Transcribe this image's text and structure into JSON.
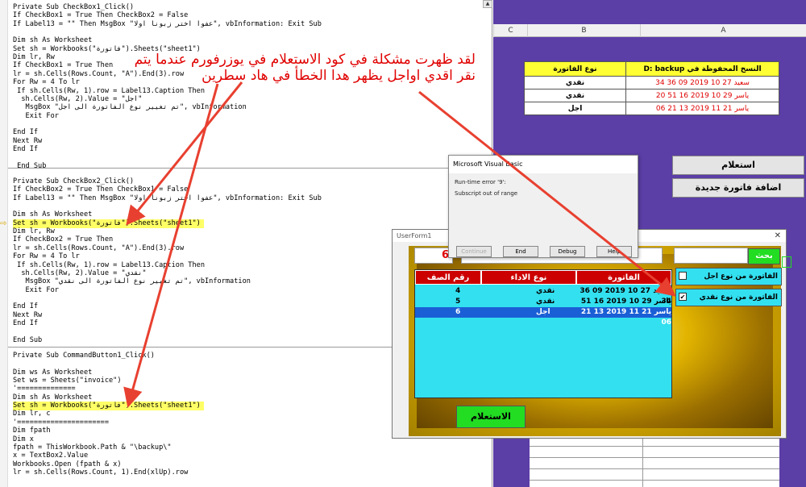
{
  "code": {
    "lines": [
      {
        "text": "Private Sub CheckBox1_Click()"
      },
      {
        "text": "If CheckBox1 = True Then CheckBox2 = False"
      },
      {
        "text": "If Label13 = \"\" Then MsgBox \"عفوا اختر زبونا اولا\", vbInformation: Exit Sub"
      },
      {
        "text": ""
      },
      {
        "text": "Dim sh As Worksheet"
      },
      {
        "text": "Set sh = Workbooks(\"فاتورة\").Sheets(\"sheet1\")"
      },
      {
        "text": "Dim lr, Rw"
      },
      {
        "text": "If CheckBox1 = True Then"
      },
      {
        "text": "lr = sh.Cells(Rows.Count, \"A\").End(3).row"
      },
      {
        "text": "For Rw = 4 To lr"
      },
      {
        "text": " If sh.Cells(Rw, 1).row = Label13.Caption Then"
      },
      {
        "text": "  sh.Cells(Rw, 2).Value = \"اجل\""
      },
      {
        "text": "   MsgBox \"تم تغيير نوع الفاتورة الى اجل\", vbInformation"
      },
      {
        "text": "   Exit For"
      },
      {
        "text": ""
      },
      {
        "text": "End If"
      },
      {
        "text": "Next Rw"
      },
      {
        "text": "End If"
      },
      {
        "text": ""
      },
      {
        "text": " End Sub"
      },
      {
        "text": ""
      },
      {
        "text": "Private Sub CheckBox2_Click()"
      },
      {
        "text": "If CheckBox2 = True Then CheckBox1 = False"
      },
      {
        "text": "If Label13 = \"\" Then MsgBox \"عفوا اختر زبونا اولا\", vbInformation: Exit Sub"
      },
      {
        "text": ""
      },
      {
        "text": "Dim sh As Worksheet"
      },
      {
        "text": "Set sh = Workbooks(\"فاتورة\").Sheets(\"sheet1\")",
        "highlight": true
      },
      {
        "text": "Dim lr, Rw"
      },
      {
        "text": "If CheckBox2 = True Then"
      },
      {
        "text": "lr = sh.Cells(Rows.Count, \"A\").End(3).row"
      },
      {
        "text": "For Rw = 4 To lr"
      },
      {
        "text": " If sh.Cells(Rw, 1).row = Label13.Caption Then"
      },
      {
        "text": "  sh.Cells(Rw, 2).Value = \"نقدي\""
      },
      {
        "text": "   MsgBox \"تم تغيير نوع الفاتورة الى نقدي\", vbInformation"
      },
      {
        "text": "   Exit For"
      },
      {
        "text": ""
      },
      {
        "text": "End If"
      },
      {
        "text": "Next Rw"
      },
      {
        "text": "End If"
      },
      {
        "text": ""
      },
      {
        "text": "End Sub"
      },
      {
        "text": ""
      },
      {
        "text": "Private Sub CommandButton1_Click()"
      },
      {
        "text": ""
      },
      {
        "text": "Dim ws As Worksheet"
      },
      {
        "text": "Set ws = Sheets(\"invoice\")"
      },
      {
        "text": "'=============="
      },
      {
        "text": "Dim sh As Worksheet"
      },
      {
        "text": "Set sh = Workbooks(\"فاتورة\").Sheets(\"sheet1\")",
        "highlight": true
      },
      {
        "text": "Dim lr, c"
      },
      {
        "text": "'======================"
      },
      {
        "text": "Dim fpath"
      },
      {
        "text": "Dim x"
      },
      {
        "text": "fpath = ThisWorkbook.Path & \"\\backup\\\""
      },
      {
        "text": "x = TextBox2.Value"
      },
      {
        "text": "Workbooks.Open (fpath & x)"
      },
      {
        "text": "lr = sh.Cells(Rows.Count, 1).End(xlUp).row"
      }
    ]
  },
  "annotation": {
    "line1": "لقد ظهرت مشكلة في كود الاستعلام في يوزرفورم عندما يتم",
    "line2": "نقر اقدي اواجل يظهر هدا الخطأ في هاد سطرين"
  },
  "sheet": {
    "col_headers": [
      "C",
      "B",
      "A"
    ],
    "table": {
      "header_b": "نوع الفاتورة",
      "header_a": "النسخ المحفوظة في D: backup",
      "rows": [
        {
          "b": "نقدي",
          "a": "سعيد 27 10 2019 09 36 34"
        },
        {
          "b": "نقدي",
          "a": "ياسر 29 10 2019 16 51 20"
        },
        {
          "b": "اجل",
          "a": "ياسر 21 11 2019 13 21 06"
        }
      ]
    },
    "btn_query": "استعلام",
    "btn_add_invoice": "اضافة فاتورة جديدة"
  },
  "error_dialog": {
    "title": "Microsoft Visual Basic",
    "error_code": "Run-time error '9':",
    "message": "Subscript out of range",
    "buttons": {
      "continue": "Continue",
      "end": "End",
      "debug": "Debug",
      "help": "Help"
    }
  },
  "userform": {
    "title": "UserForm1",
    "close": "✕",
    "label_count": "6",
    "search_button": "بحث",
    "list_headers": {
      "row_num": "رقم الصف",
      "pay_type": "نوع الاداء",
      "invoice": "الفاتورة"
    },
    "list_rows": [
      {
        "num": "4",
        "type": "نقدي",
        "invoice": "سعيد 27 10 2019 09 36 34",
        "selected": false
      },
      {
        "num": "5",
        "type": "نقدي",
        "invoice": "ياسر 29 10 2019 16 51 20",
        "selected": false
      },
      {
        "num": "6",
        "type": "اجل",
        "invoice": "ياسر 21 11 2019 13 21 06",
        "selected": true
      }
    ],
    "checkbox_credit": {
      "label": "الفاتورة من نوع اجل",
      "checked": false
    },
    "checkbox_cash": {
      "label": "الفاتورة من نوع نقدي",
      "checked": true
    },
    "query_button": "الاستعلام"
  },
  "colors": {
    "annotation": "#e00000",
    "highlight": "#ffff66",
    "sheet_bg": "#5b3ea6",
    "list_bg": "#33e0f0",
    "header_red": "#cc0000",
    "btn_green": "#22dd22"
  }
}
